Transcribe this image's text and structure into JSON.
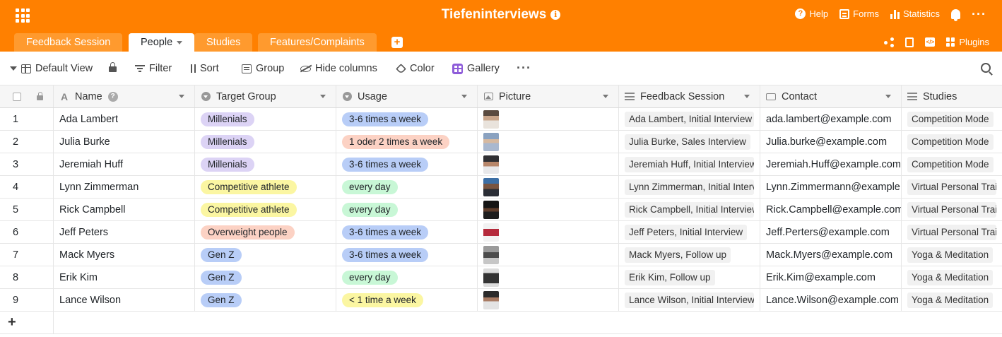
{
  "header": {
    "title": "Tiefeninterviews",
    "actions": {
      "help": "Help",
      "forms": "Forms",
      "statistics": "Statistics"
    }
  },
  "tabs": [
    {
      "label": "Feedback Session"
    },
    {
      "label": "People"
    },
    {
      "label": "Studies"
    },
    {
      "label": "Features/Complaints"
    }
  ],
  "tab_actions": {
    "plugins": "Plugins"
  },
  "toolbar": {
    "view": "Default View",
    "filter": "Filter",
    "sort": "Sort",
    "group": "Group",
    "hide_columns": "Hide columns",
    "color": "Color",
    "gallery": "Gallery"
  },
  "columns": {
    "name": "Name",
    "target_group": "Target Group",
    "usage": "Usage",
    "picture": "Picture",
    "feedback_session": "Feedback Session",
    "contact": "Contact",
    "studies": "Studies"
  },
  "rows": [
    {
      "idx": "1",
      "name": "Ada Lambert",
      "target_group": "Millenials",
      "usage": "3-6 times a week",
      "feedback_session": "Ada Lambert, Initial Interview",
      "contact": "ada.lambert@example.com",
      "studies": "Competition Mode"
    },
    {
      "idx": "2",
      "name": "Julia Burke",
      "target_group": "Millenials",
      "usage": "1 oder 2 times a week",
      "feedback_session": "Julia Burke, Sales Interview",
      "contact": "Julia.burke@example.com",
      "studies": "Competition Mode"
    },
    {
      "idx": "3",
      "name": "Jeremiah Huff",
      "target_group": "Millenials",
      "usage": "3-6 times a week",
      "feedback_session": "Jeremiah Huff, Initial Interview",
      "contact": "Jeremiah.Huff@example.com",
      "studies": "Competition Mode"
    },
    {
      "idx": "4",
      "name": "Lynn Zimmerman",
      "target_group": "Competitive athlete",
      "usage": "every day",
      "feedback_session": "Lynn Zimmerman, Initial Interview",
      "contact": "Lynn.Zimmermann@example.com",
      "studies": "Virtual Personal Trainer"
    },
    {
      "idx": "5",
      "name": "Rick Campbell",
      "target_group": "Competitive athlete",
      "usage": "every day",
      "feedback_session": "Rick Campbell, Initial Interview",
      "contact": "Rick.Campbell@example.com",
      "studies": "Virtual Personal Trainer"
    },
    {
      "idx": "6",
      "name": "Jeff Peters",
      "target_group": "Overweight people",
      "usage": "3-6 times a week",
      "feedback_session": "Jeff Peters, Initial Interview",
      "contact": "Jeff.Perters@example.com",
      "studies": "Virtual Personal Trainer"
    },
    {
      "idx": "7",
      "name": "Mack Myers",
      "target_group": "Gen Z",
      "usage": "3-6 times a week",
      "feedback_session": "Mack Myers, Follow up",
      "contact": "Mack.Myers@example.com",
      "studies": "Yoga & Meditation"
    },
    {
      "idx": "8",
      "name": "Erik Kim",
      "target_group": "Gen Z",
      "usage": "every day",
      "feedback_session": "Erik Kim, Follow up",
      "contact": "Erik.Kim@example.com",
      "studies": "Yoga & Meditation"
    },
    {
      "idx": "9",
      "name": "Lance Wilson",
      "target_group": "Gen Z",
      "usage": "< 1 time a week",
      "feedback_session": "Lance Wilson, Initial Interview",
      "contact": "Lance.Wilson@example.com",
      "studies": "Yoga & Meditation"
    }
  ],
  "add_row": "+",
  "colors": {
    "brand": "#ff8000",
    "millenials": "#dcd3f5",
    "competitive": "#fbf6a2",
    "overweight": "#fcd2c4",
    "genz": "#b8cdf7",
    "every_day": "#c8f7d6"
  }
}
